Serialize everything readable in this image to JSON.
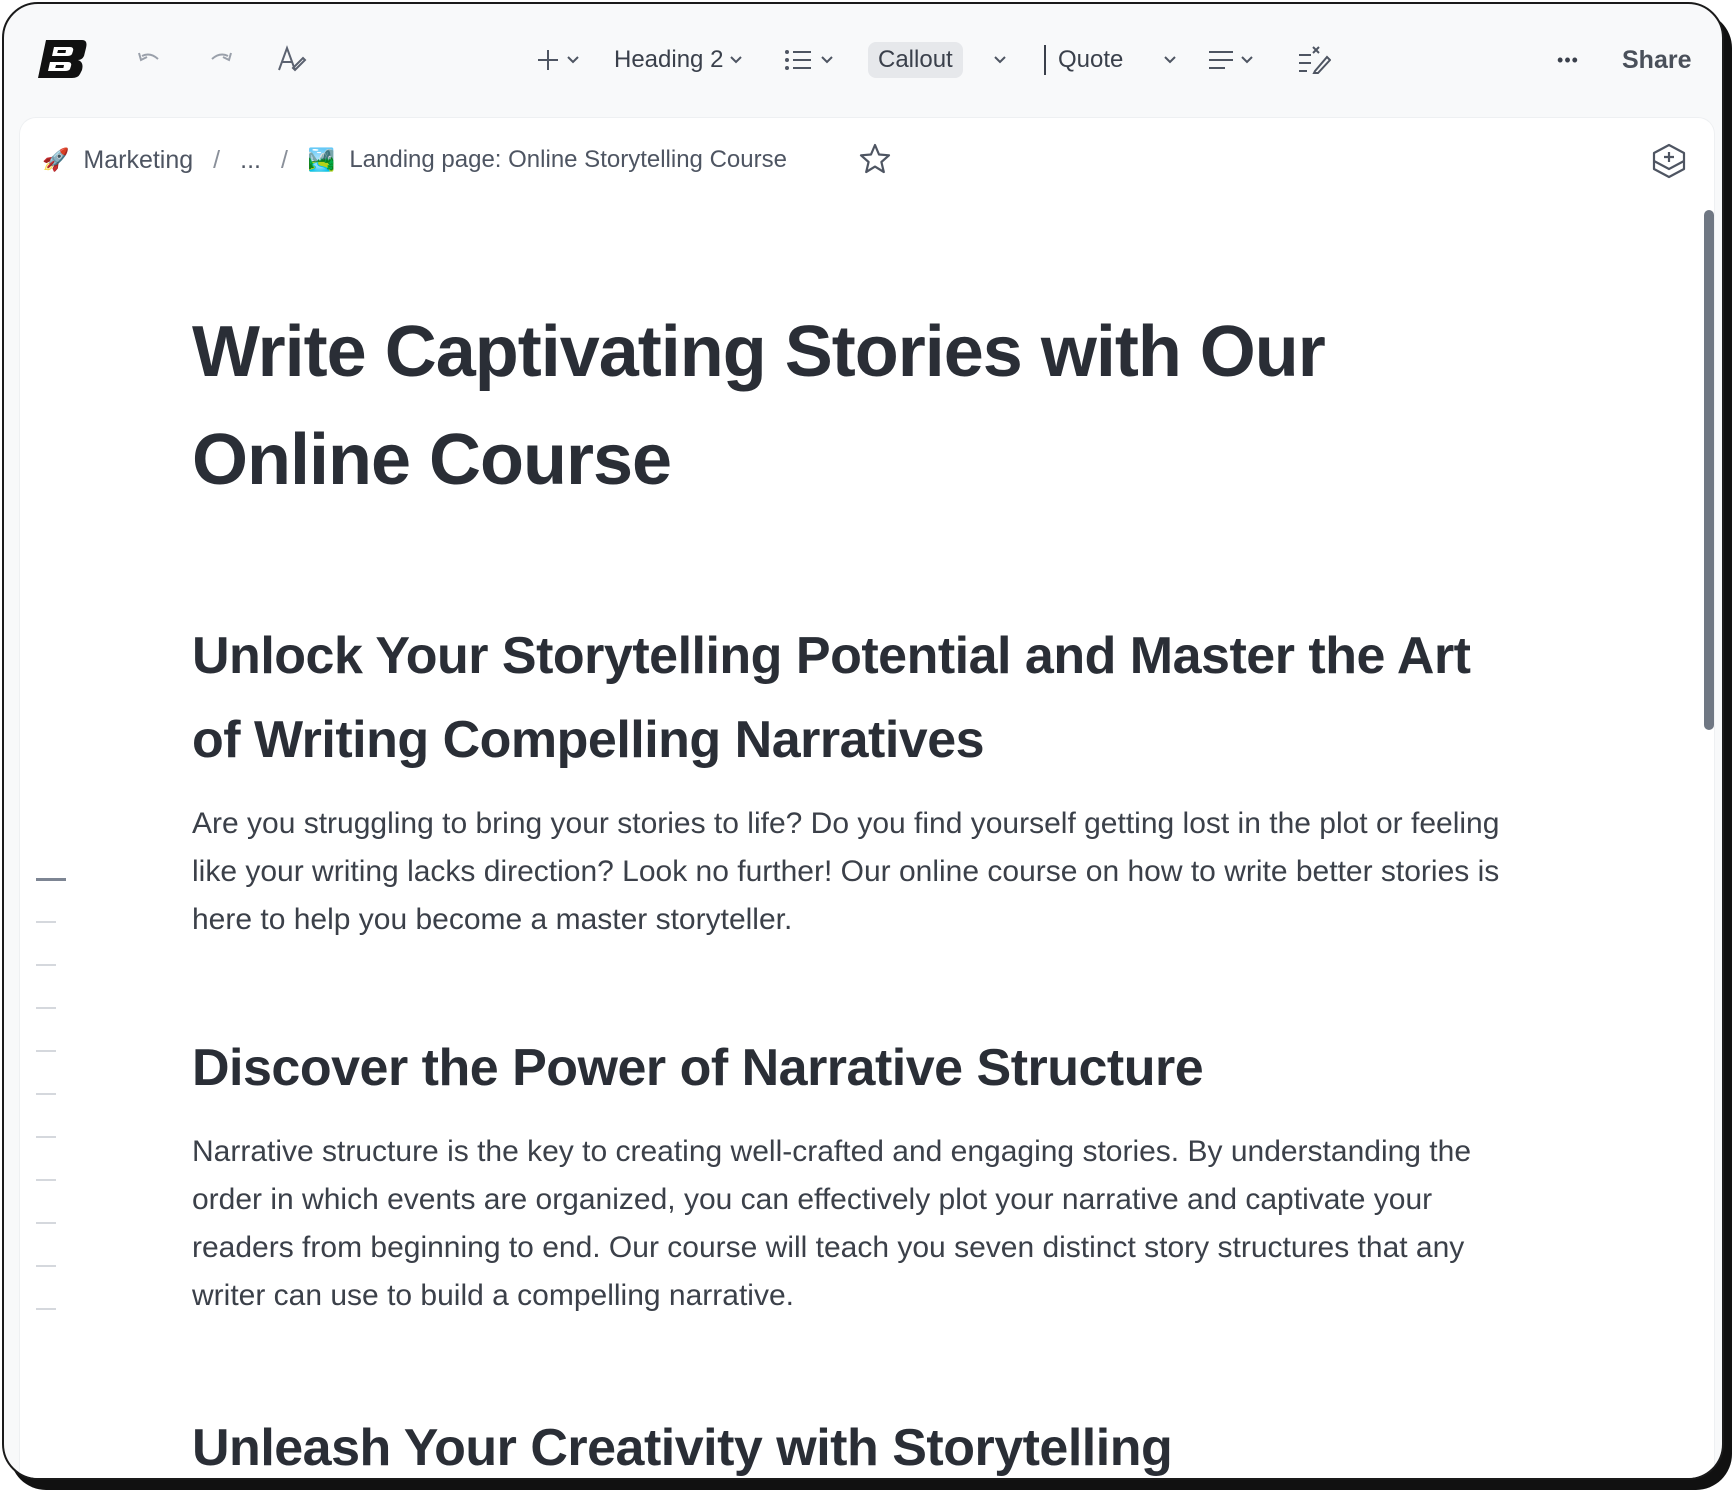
{
  "toolbar": {
    "heading_label": "Heading 2",
    "callout_label": "Callout",
    "quote_label": "Quote",
    "more_label": "•••",
    "share_label": "Share"
  },
  "breadcrumb": {
    "root_emoji": "🚀",
    "root_label": "Marketing",
    "separator": "/",
    "ellipsis": "...",
    "page_emoji": "🏞️",
    "page_label": "Landing page: Online Storytelling Course"
  },
  "document": {
    "title": "Write Captivating Stories with Our Online Course",
    "sections": [
      {
        "heading": "Unlock Your Storytelling Potential and Master the Art of Writing Compelling Narratives",
        "body": "Are you struggling to bring your stories to life? Do you find yourself getting lost in the plot or feeling like your writing lacks direction? Look no further! Our online course on how to write better stories is here to help you become a master storyteller."
      },
      {
        "heading": "Discover the Power of Narrative Structure",
        "body": "Narrative structure is the key to creating well-crafted and engaging stories. By understanding the order in which events are organized, you can effectively plot your narrative and captivate your readers from beginning to end. Our course will teach you seven distinct story structures that any writer can use to build a compelling narrative."
      },
      {
        "heading": "Unleash Your Creativity with Storytelling"
      }
    ]
  },
  "colors": {
    "text": "#2a2e36",
    "body_text": "#3b4049",
    "scrollbar": "#6f7783",
    "callout_bg": "#e6e8eb"
  }
}
